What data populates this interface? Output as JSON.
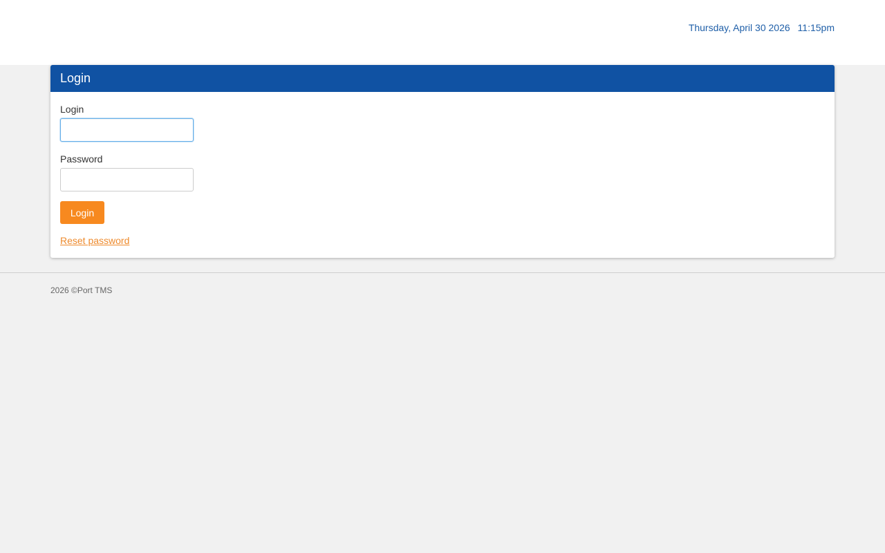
{
  "header": {
    "date": "Thursday, April 30 2026",
    "time": "11:15pm"
  },
  "login_panel": {
    "title": "Login",
    "login_label": "Login",
    "login_value": "",
    "password_label": "Password",
    "password_value": "",
    "submit_label": "Login",
    "reset_link": "Reset password"
  },
  "footer": {
    "copyright": "2026 ©Port TMS"
  },
  "colors": {
    "panel_header": "#1052a3",
    "button": "#f7891f",
    "link": "#ee8a2c",
    "datetime": "#1f5fa8",
    "background": "#f1f1f1"
  }
}
